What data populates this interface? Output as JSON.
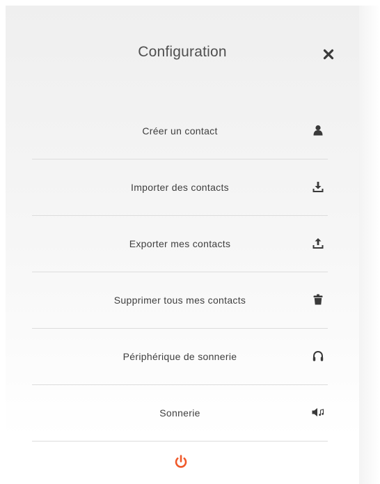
{
  "header": {
    "title": "Configuration",
    "close_icon": "close-icon"
  },
  "menu": {
    "items": [
      {
        "label": "Créer un contact",
        "icon": "user-icon"
      },
      {
        "label": "Importer des contacts",
        "icon": "download-icon"
      },
      {
        "label": "Exporter mes contacts",
        "icon": "upload-icon"
      },
      {
        "label": "Supprimer tous mes contacts",
        "icon": "trash-icon"
      },
      {
        "label": "Périphérique de sonnerie",
        "icon": "headphones-icon"
      },
      {
        "label": "Sonnerie",
        "icon": "speaker-music-icon"
      }
    ]
  },
  "footer": {
    "power_icon": "power-icon"
  },
  "colors": {
    "accent": "#f0592a",
    "text": "#3e3e3e",
    "icon": "#3a3a3a",
    "divider": "#dcdcdc"
  }
}
